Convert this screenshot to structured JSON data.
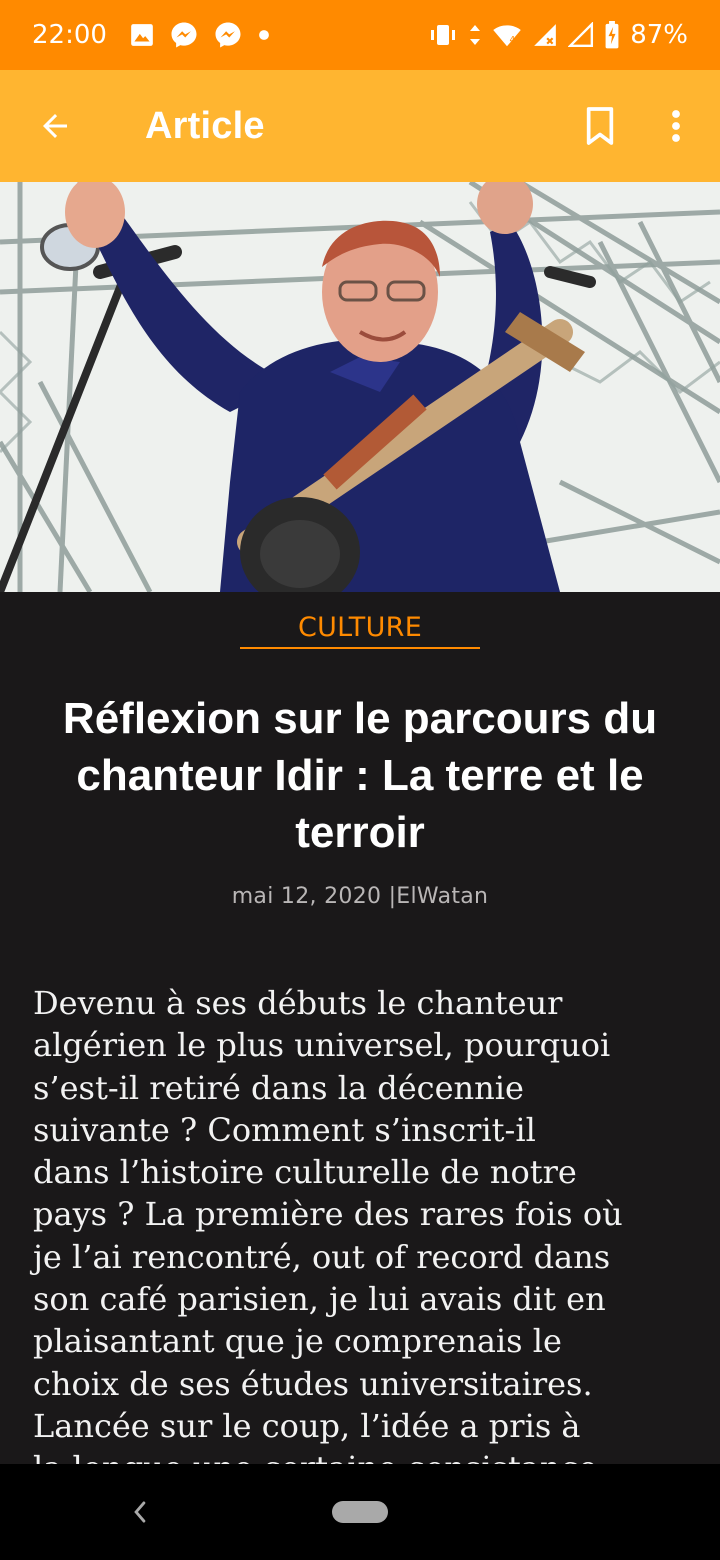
{
  "status_bar": {
    "time": "22:00",
    "battery_percent": "87%",
    "icons": [
      "image-icon",
      "messenger-icon",
      "messenger-icon",
      "dot-icon",
      "vibrate-icon",
      "data-arrows-icon",
      "wifi-icon",
      "signal-icon",
      "signal-icon",
      "battery-charging-icon"
    ]
  },
  "app_bar": {
    "title": "Article",
    "icons": [
      "back-arrow-icon",
      "bookmark-icon",
      "more-vert-icon"
    ]
  },
  "article": {
    "category": "CULTURE",
    "title": "Réflexion sur le parcours du chanteur Idir : La terre et le terroir",
    "date": "mai 12, 2020",
    "source": "|ElWatan",
    "body": "Devenu à ses débuts le chanteur\nalgérien le plus universel, pourquoi\ns’est-il retiré dans la décennie\nsuivante ? Comment s’inscrit-il\ndans l’histoire culturelle de notre\npays ? La première des rares fois où\nje l’ai rencontré, out of record dans\nson café parisien, je lui avais dit en\nplaisantant que je comprenais le\nchoix de ses études universitaires.\nLancée sur le coup, l’idée a pris à\nla longue une certaine consistance."
  },
  "colors": {
    "status_bar": "#ff8a00",
    "app_bar": "#ffb530",
    "accent": "#ff8a00",
    "background": "#1a1819"
  },
  "nav_bar": {
    "icons": [
      "nav-back-icon",
      "home-pill-icon"
    ]
  }
}
